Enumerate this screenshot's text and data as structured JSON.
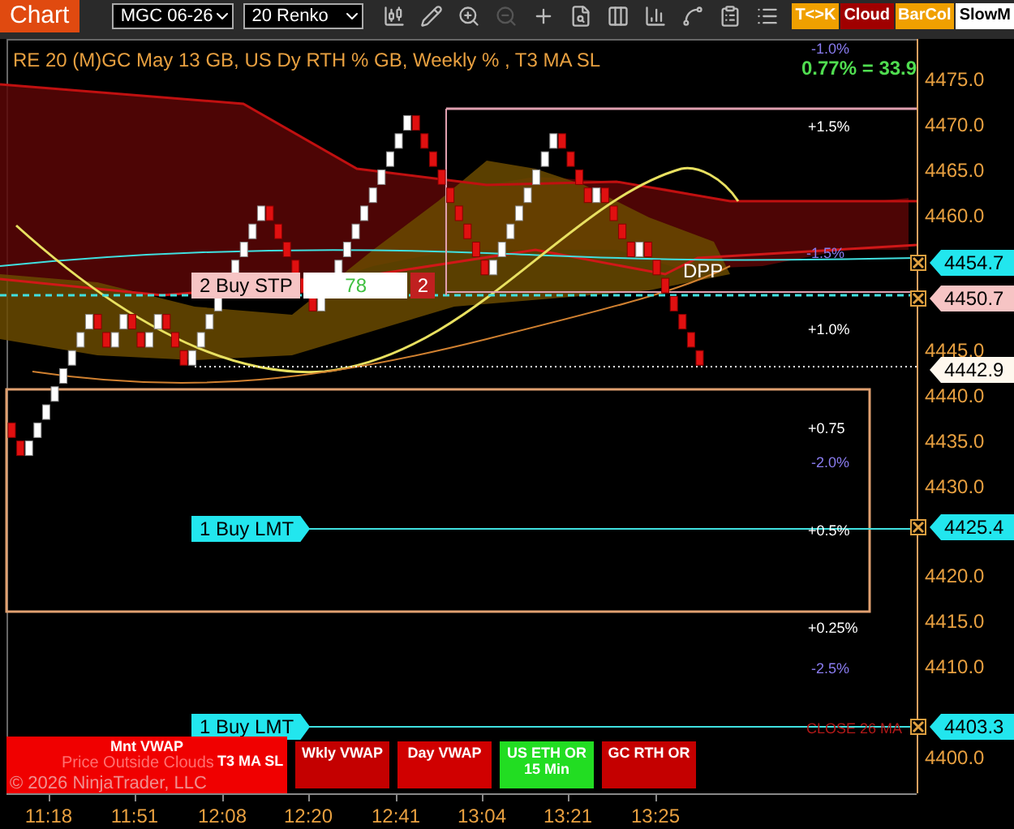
{
  "toolbar": {
    "tab": "Chart",
    "instrument": "MGC 06-26",
    "bar_type": "20 Renko",
    "toggles": [
      {
        "label": "T<>K",
        "color": "#f0a000"
      },
      {
        "label": "Cloud",
        "color": "#a00000"
      },
      {
        "label": "BarCol",
        "color": "#f0a000"
      },
      {
        "label": "SlowM",
        "color": "#ffffff"
      }
    ]
  },
  "chart": {
    "title": "RE 20  (M)GC May 13 GB, US Dy RTH % GB, Weekly % , T3 MA SL",
    "summary": "0.77% = 33.9",
    "pivot": "DPP",
    "percent_labels": [
      {
        "text": "-1.0%",
        "kind": "negative"
      },
      {
        "text": "+1.5%",
        "kind": "positive"
      },
      {
        "text": "-1.5%",
        "kind": "negative"
      },
      {
        "text": "+1.0%",
        "kind": "positive"
      },
      {
        "text": "+0.75",
        "kind": "positive"
      },
      {
        "text": "-2.0%",
        "kind": "negative"
      },
      {
        "text": "+0.5%",
        "kind": "positive"
      },
      {
        "text": "+0.25%",
        "kind": "positive"
      },
      {
        "text": "-2.5%",
        "kind": "negative"
      },
      {
        "text": "CLOSE 26 MA",
        "kind": "close"
      }
    ],
    "orders": [
      {
        "label": "2 Buy STP",
        "kind": "stop",
        "quantity": "78",
        "count": "2"
      },
      {
        "label": "1 Buy LMT",
        "kind": "limit"
      },
      {
        "label": "1 Buy LMT",
        "kind": "limit"
      }
    ],
    "price_markers": [
      {
        "text": "4454.7",
        "kind": "cyan"
      },
      {
        "text": "4450.7",
        "kind": "pink"
      },
      {
        "text": "4442.9",
        "kind": "white"
      },
      {
        "text": "4425.4",
        "kind": "cyan"
      },
      {
        "text": "4403.3",
        "kind": "cyan"
      }
    ],
    "price_axis": [
      "4475.0",
      "4470.0",
      "4465.0",
      "4460.0",
      "4445.0",
      "4440.0",
      "4435.0",
      "4430.0",
      "4420.0",
      "4415.0",
      "4410.0",
      "4400.0"
    ],
    "time_axis": [
      "11:18",
      "11:51",
      "12:08",
      "12:20",
      "12:41",
      "13:04",
      "13:21",
      "13:25"
    ],
    "indicator_panel": {
      "title": "Mnt VWAP",
      "alert": "Price Outside Clouds",
      "copyright": "© 2026 NinjaTrader, LLC",
      "subtitle": "T3 MA SL"
    },
    "indicator_buttons": [
      {
        "label": "Wkly VWAP",
        "color": "#c40000"
      },
      {
        "label": "Day VWAP",
        "color": "#d00000"
      },
      {
        "label": "US ETH OR 15 Min",
        "color": "#22dd22"
      },
      {
        "label": "GC RTH OR",
        "color": "#c40000"
      }
    ]
  }
}
